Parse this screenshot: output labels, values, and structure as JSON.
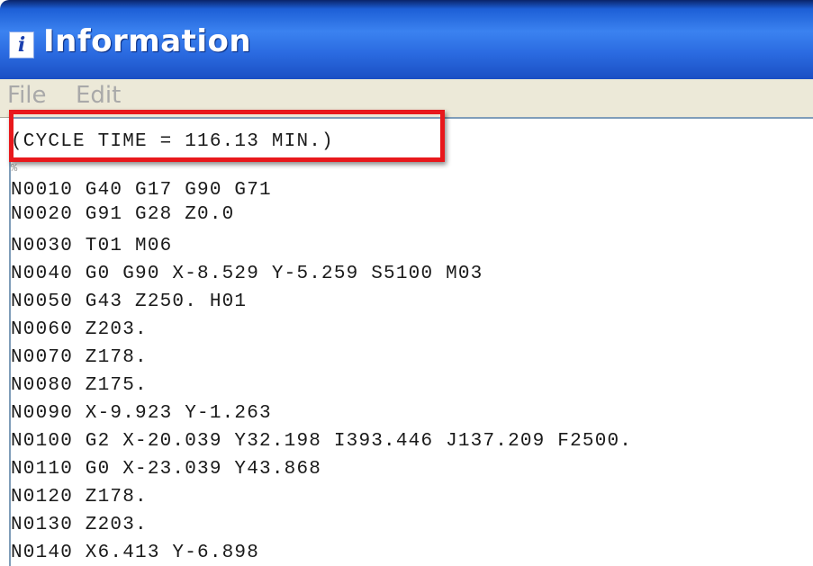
{
  "window": {
    "title": "Information",
    "icon": "info-icon"
  },
  "menubar": {
    "items": [
      {
        "label": "File"
      },
      {
        "label": "Edit"
      }
    ]
  },
  "editor": {
    "lines": [
      "(CYCLE TIME = 116.13 MIN.)",
      "%",
      "N0010 G40 G17 G90 G71",
      "N0020 G91 G28 Z0.0",
      "N0030 T01 M06",
      "N0040 G0 G90 X-8.529 Y-5.259 S5100 M03",
      "N0050 G43 Z250. H01",
      "N0060 Z203.",
      "N0070 Z178.",
      "N0080 Z175.",
      "N0090 X-9.923 Y-1.263",
      "N0100 G2 X-20.039 Y32.198 I393.446 J137.209 F2500.",
      "N0110 G0 X-23.039 Y43.868",
      "N0120 Z178.",
      "N0130 Z203.",
      "N0140 X6.413 Y-6.898"
    ]
  },
  "annotation": {
    "highlight_color": "#e8181c"
  }
}
